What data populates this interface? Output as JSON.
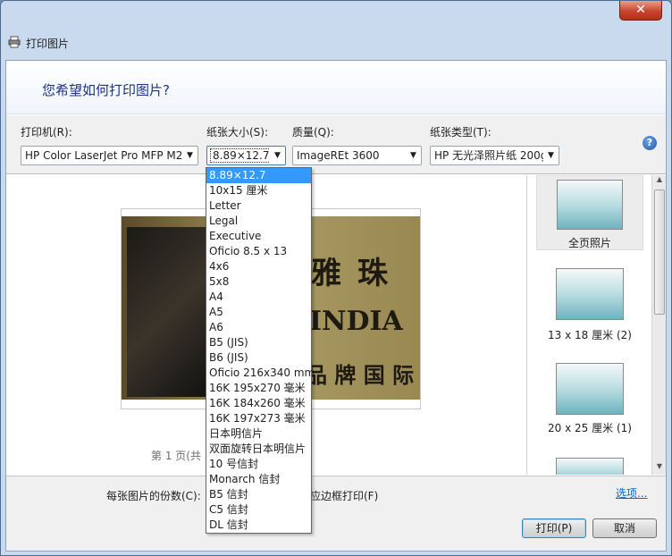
{
  "window": {
    "title": "打印图片",
    "close_label": "✕",
    "question": "您希望如何打印图片?"
  },
  "options": {
    "printer_label": "打印机(R):",
    "printer_value": "HP Color LaserJet Pro MFP M2",
    "paper_size_label": "纸张大小(S):",
    "paper_size_value": "8.89×12.7",
    "quality_label": "质量(Q):",
    "quality_value": "ImageREt 3600",
    "paper_type_label": "纸张类型(T):",
    "paper_type_value": "HP 无光泽照片纸 200g",
    "help_label": "?"
  },
  "preview": {
    "page_indicator": "第 1 页(共"
  },
  "thumbnails": [
    {
      "label": "全页照片"
    },
    {
      "label": "13 x 18 厘米 (2)"
    },
    {
      "label": "20 x 25 厘米 (1)"
    }
  ],
  "footer": {
    "copies_label": "每张图片的份数(C):",
    "fit_label": "应边框打印(F)",
    "options_link": "选项...",
    "print_button": "打印(P)",
    "cancel_button": "取消"
  },
  "paper_size_options": [
    "8.89×12.7",
    "10x15 厘米",
    "Letter",
    "Legal",
    "Executive",
    "Oficio 8.5 x 13",
    "4x6",
    "5x8",
    "A4",
    "A5",
    "A6",
    "B5 (JIS)",
    "B6 (JIS)",
    "Oficio 216x340 mm",
    "16K 195x270 毫米",
    "16K 184x260 毫米",
    "16K 197x273 毫米",
    "日本明信片",
    "双面旋转日本明信片",
    "10 号信封",
    "Monarch 信封",
    "B5 信封",
    "C5 信封",
    "DL 信封"
  ],
  "selected_paper_size_index": 0,
  "colors": {
    "accent": "#3399ff",
    "question_text": "#1e3287",
    "link": "#0066cc",
    "close_button": "#c8452d"
  }
}
